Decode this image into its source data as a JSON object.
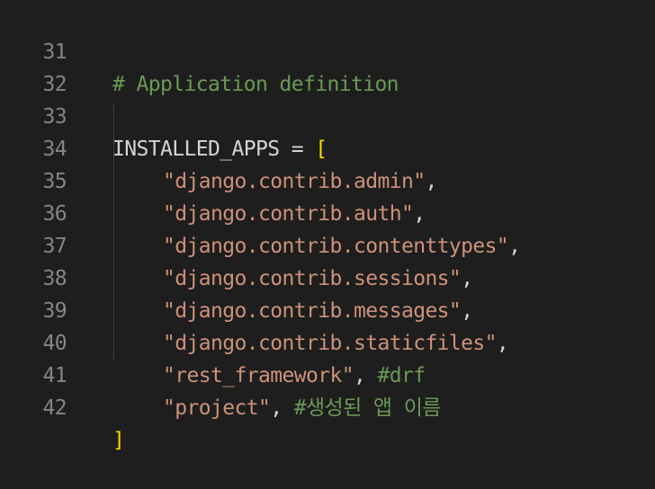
{
  "editor": {
    "lines": [
      {
        "num": "31",
        "comment": "# Application definition"
      },
      {
        "num": "32"
      },
      {
        "num": "33",
        "text": "INSTALLED_APPS = ",
        "bracket": "["
      },
      {
        "num": "34",
        "string": "\"django.contrib.admin\"",
        "text": ","
      },
      {
        "num": "35",
        "string": "\"django.contrib.auth\"",
        "text": ","
      },
      {
        "num": "36",
        "string": "\"django.contrib.contenttypes\"",
        "text": ","
      },
      {
        "num": "37",
        "string": "\"django.contrib.sessions\"",
        "text": ","
      },
      {
        "num": "38",
        "string": "\"django.contrib.messages\"",
        "text": ","
      },
      {
        "num": "39",
        "string": "\"django.contrib.staticfiles\"",
        "text": ","
      },
      {
        "num": "40",
        "string": "\"rest_framework\"",
        "text": ", ",
        "comment": "#drf"
      },
      {
        "num": "41",
        "string": "\"project\"",
        "text": ", ",
        "comment": "#생성된 앱 이름"
      },
      {
        "num": "42",
        "bracket": "]"
      }
    ]
  }
}
